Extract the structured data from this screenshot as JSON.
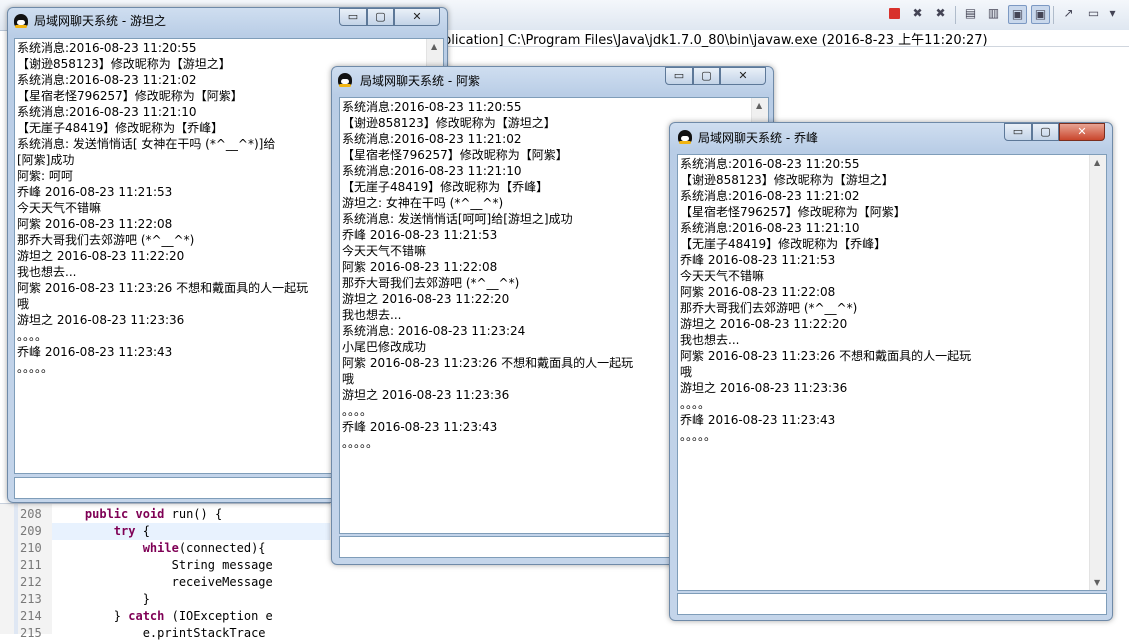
{
  "console": {
    "path_text": "plication] C:\\Program Files\\Java\\jdk1.7.0_80\\bin\\javaw.exe (2016-8-23 上午11:20:27)"
  },
  "toolbar": {
    "icons": [
      "stop-icon",
      "remove-icon",
      "remove-all-icon",
      "clear-console-icon",
      "scroll-lock-icon",
      "pin-console-icon",
      "display-console-icon",
      "open-console-icon",
      "new-console-icon",
      "view-menu-icon"
    ]
  },
  "editor": {
    "lines": [
      {
        "num": "208",
        "code": "    public void run() {"
      },
      {
        "num": "209",
        "code": "        try {"
      },
      {
        "num": "210",
        "code": "            while(connected){"
      },
      {
        "num": "211",
        "code": "                String message"
      },
      {
        "num": "212",
        "code": "                receiveMessage"
      },
      {
        "num": "213",
        "code": "            }"
      },
      {
        "num": "214",
        "code": "        } catch (IOException e"
      },
      {
        "num": "215",
        "code": "            e.printStackTrace"
      }
    ]
  },
  "windows": [
    {
      "title": "局域网聊天系统 - 游坦之",
      "buttons": {
        "minimize": "▭",
        "maximize": "▢",
        "close": "✕"
      },
      "input_value": "",
      "messages": [
        "系统消息:2016-08-23 11:20:55",
        "【谢逊858123】修改昵称为【游坦之】",
        "系统消息:2016-08-23 11:21:02",
        "【星宿老怪796257】修改昵称为【阿紫】",
        "系统消息:2016-08-23 11:21:10",
        "【无崖子48419】修改昵称为【乔峰】",
        "系统消息: 发送悄悄话[ 女神在干吗 (*^__^*)]给",
        "[阿紫]成功",
        "阿紫:  呵呵",
        "乔峰 2016-08-23 11:21:53",
        "今天天气不错嘛",
        "阿紫 2016-08-23 11:22:08",
        "那乔大哥我们去郊游吧 (*^__^*)",
        "游坦之 2016-08-23 11:22:20",
        "我也想去...",
        "阿紫 2016-08-23 11:23:26 不想和戴面具的人一起玩",
        "哦",
        "游坦之 2016-08-23 11:23:36",
        "。。。。",
        "乔峰 2016-08-23 11:23:43",
        "。。。。。"
      ]
    },
    {
      "title": "局域网聊天系统 - 阿紫",
      "buttons": {
        "minimize": "▭",
        "maximize": "▢",
        "close": "✕"
      },
      "input_value": "",
      "messages": [
        "系统消息:2016-08-23 11:20:55",
        "【谢逊858123】修改昵称为【游坦之】",
        "系统消息:2016-08-23 11:21:02",
        "【星宿老怪796257】修改昵称为【阿紫】",
        "系统消息:2016-08-23 11:21:10",
        "【无崖子48419】修改昵称为【乔峰】",
        "游坦之:  女神在干吗 (*^__^*)",
        "系统消息: 发送悄悄话[呵呵]给[游坦之]成功",
        "乔峰 2016-08-23 11:21:53",
        "今天天气不错嘛",
        "阿紫 2016-08-23 11:22:08",
        "那乔大哥我们去郊游吧 (*^__^*)",
        "游坦之 2016-08-23 11:22:20",
        "我也想去...",
        "系统消息: 2016-08-23 11:23:24",
        "小尾巴修改成功",
        "阿紫 2016-08-23 11:23:26 不想和戴面具的人一起玩",
        "哦",
        "游坦之 2016-08-23 11:23:36",
        "。。。。",
        "乔峰 2016-08-23 11:23:43",
        "。。。。。"
      ]
    },
    {
      "title": "局域网聊天系统 - 乔峰",
      "buttons": {
        "minimize": "▭",
        "maximize": "▢",
        "close": "✕"
      },
      "input_value": "",
      "messages": [
        "系统消息:2016-08-23 11:20:55",
        "【谢逊858123】修改昵称为【游坦之】",
        "系统消息:2016-08-23 11:21:02",
        "【星宿老怪796257】修改昵称为【阿紫】",
        "系统消息:2016-08-23 11:21:10",
        "【无崖子48419】修改昵称为【乔峰】",
        "乔峰 2016-08-23 11:21:53",
        "今天天气不错嘛",
        "阿紫 2016-08-23 11:22:08",
        "那乔大哥我们去郊游吧 (*^__^*)",
        "游坦之 2016-08-23 11:22:20",
        "我也想去...",
        "阿紫 2016-08-23 11:23:26 不想和戴面具的人一起玩",
        "哦",
        "游坦之 2016-08-23 11:23:36",
        "。。。。",
        "乔峰 2016-08-23 11:23:43",
        "。。。。。"
      ]
    }
  ]
}
